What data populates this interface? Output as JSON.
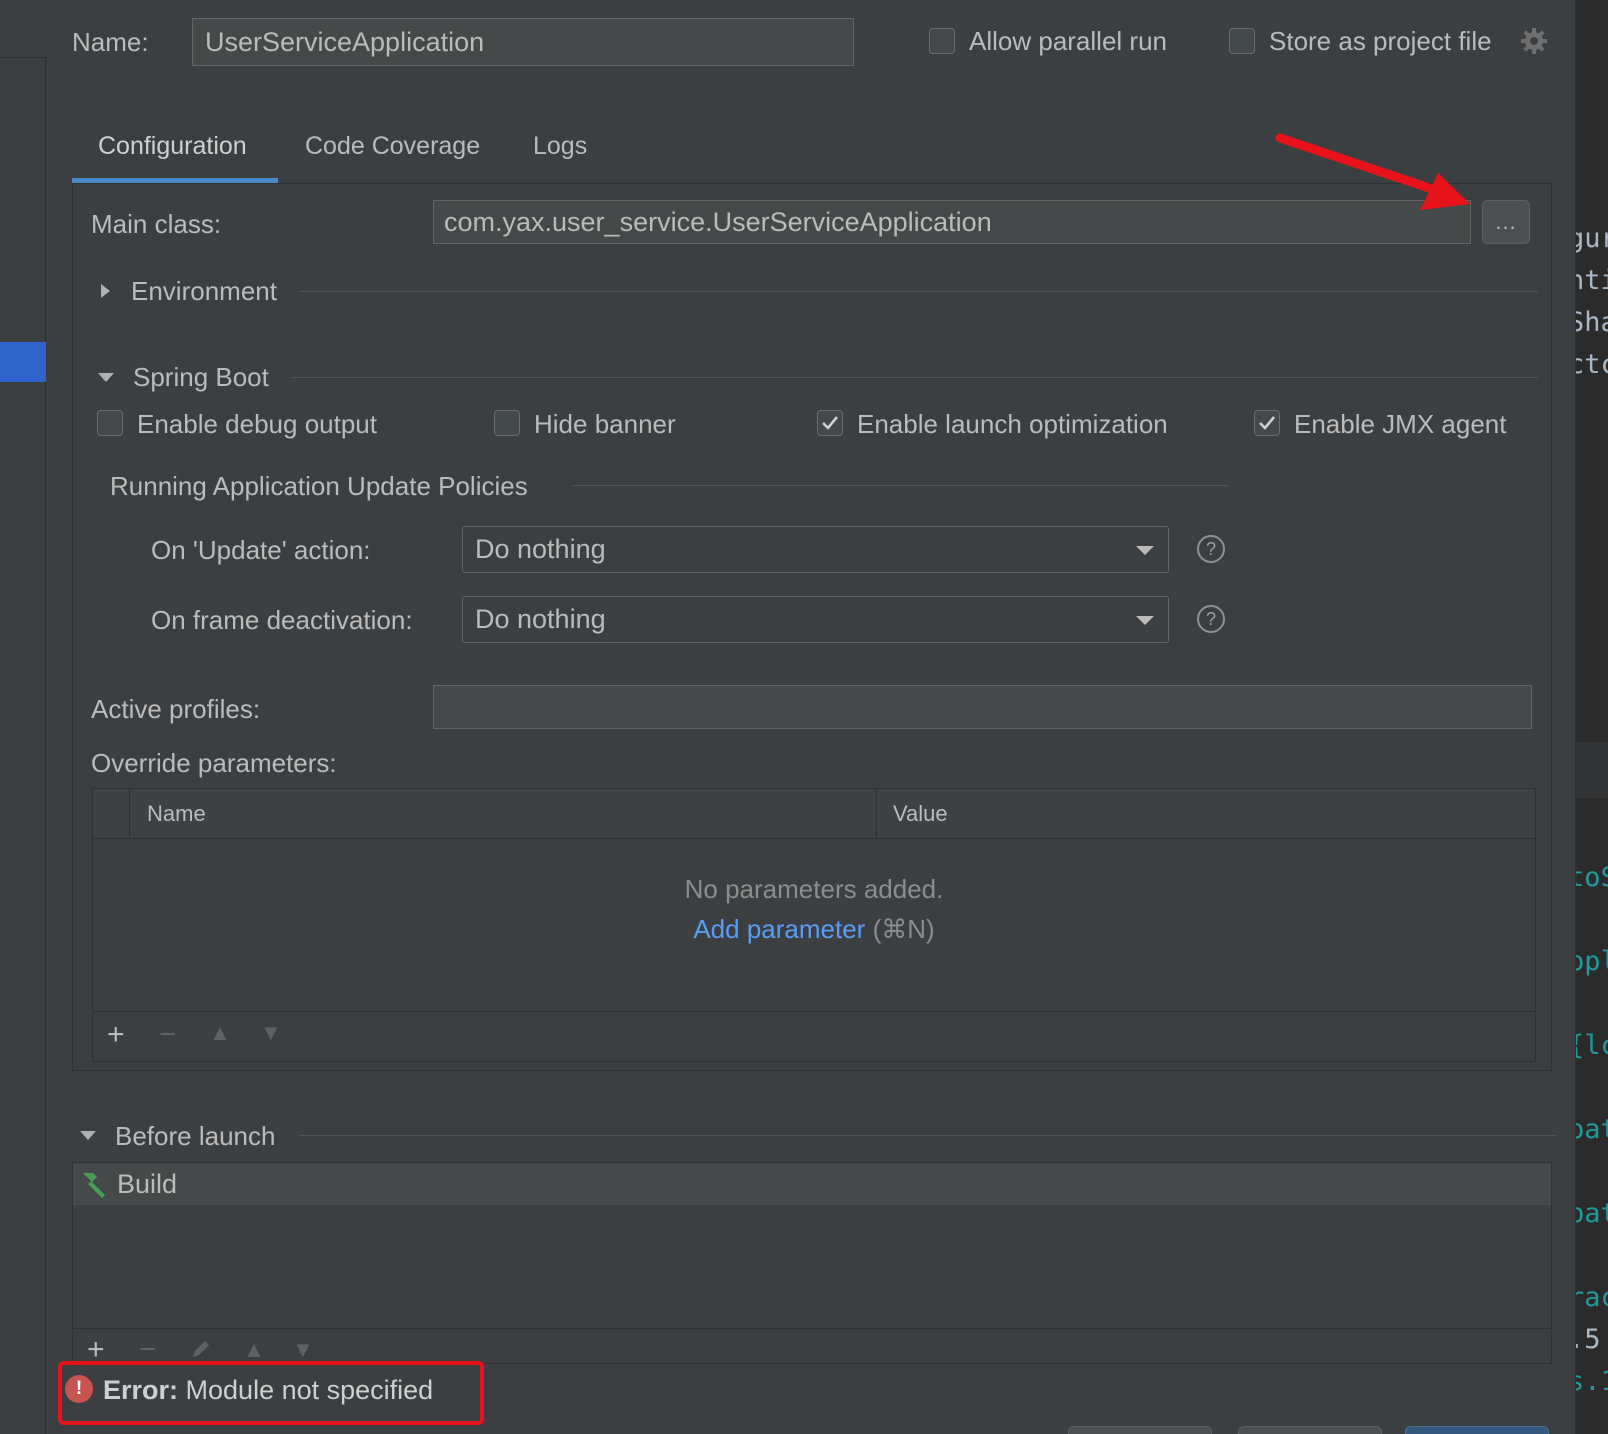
{
  "name_row": {
    "label": "Name:",
    "value": "UserServiceApplication",
    "allow_parallel_label": "Allow parallel run",
    "allow_parallel_checked": false,
    "store_project_label": "Store as project file",
    "store_project_checked": false,
    "gear_icon": "gear-icon"
  },
  "tabs": [
    {
      "label": "Configuration",
      "active": true
    },
    {
      "label": "Code Coverage",
      "active": false
    },
    {
      "label": "Logs",
      "active": false
    }
  ],
  "main_class": {
    "label": "Main class:",
    "value": "com.yax.user_service.UserServiceApplication",
    "browse_label": "..."
  },
  "environment": {
    "label": "Environment",
    "expanded": false
  },
  "spring_boot": {
    "label": "Spring Boot",
    "expanded": true,
    "options": [
      {
        "label": "Enable debug output",
        "checked": false
      },
      {
        "label": "Hide banner",
        "checked": false
      },
      {
        "label": "Enable launch optimization",
        "checked": true
      },
      {
        "label": "Enable JMX agent",
        "checked": true
      }
    ],
    "policies_title": "Running Application Update Policies",
    "on_update_label": "On 'Update' action:",
    "on_update_value": "Do nothing",
    "on_frame_label": "On frame deactivation:",
    "on_frame_value": "Do nothing",
    "help_glyph": "?"
  },
  "active_profiles": {
    "label": "Active profiles:",
    "value": ""
  },
  "override": {
    "label": "Override parameters:",
    "columns": [
      "Name",
      "Value"
    ],
    "empty_text": "No parameters added.",
    "add_link": "Add parameter",
    "add_shortcut": "(⌘N)",
    "toolbar": [
      "+",
      "−",
      "▲",
      "▼"
    ]
  },
  "before_launch": {
    "label": "Before launch",
    "items": [
      {
        "label": "Build",
        "icon": "hammer-icon"
      }
    ]
  },
  "error": {
    "prefix": "Error:",
    "message": "Module not specified"
  },
  "editor_fragments": [
    "gur",
    "nti",
    "Sha",
    "ctc",
    "toS",
    "ppl",
    "{lc",
    "pat",
    "pat",
    "rac",
    ".5",
    "s.1"
  ],
  "colors": {
    "background": "#3c3f41",
    "accent": "#4a88c7",
    "link": "#589df6",
    "error": "#e8121b",
    "annotation_arrow": "#e8121b",
    "build_icon": "#499c54"
  }
}
